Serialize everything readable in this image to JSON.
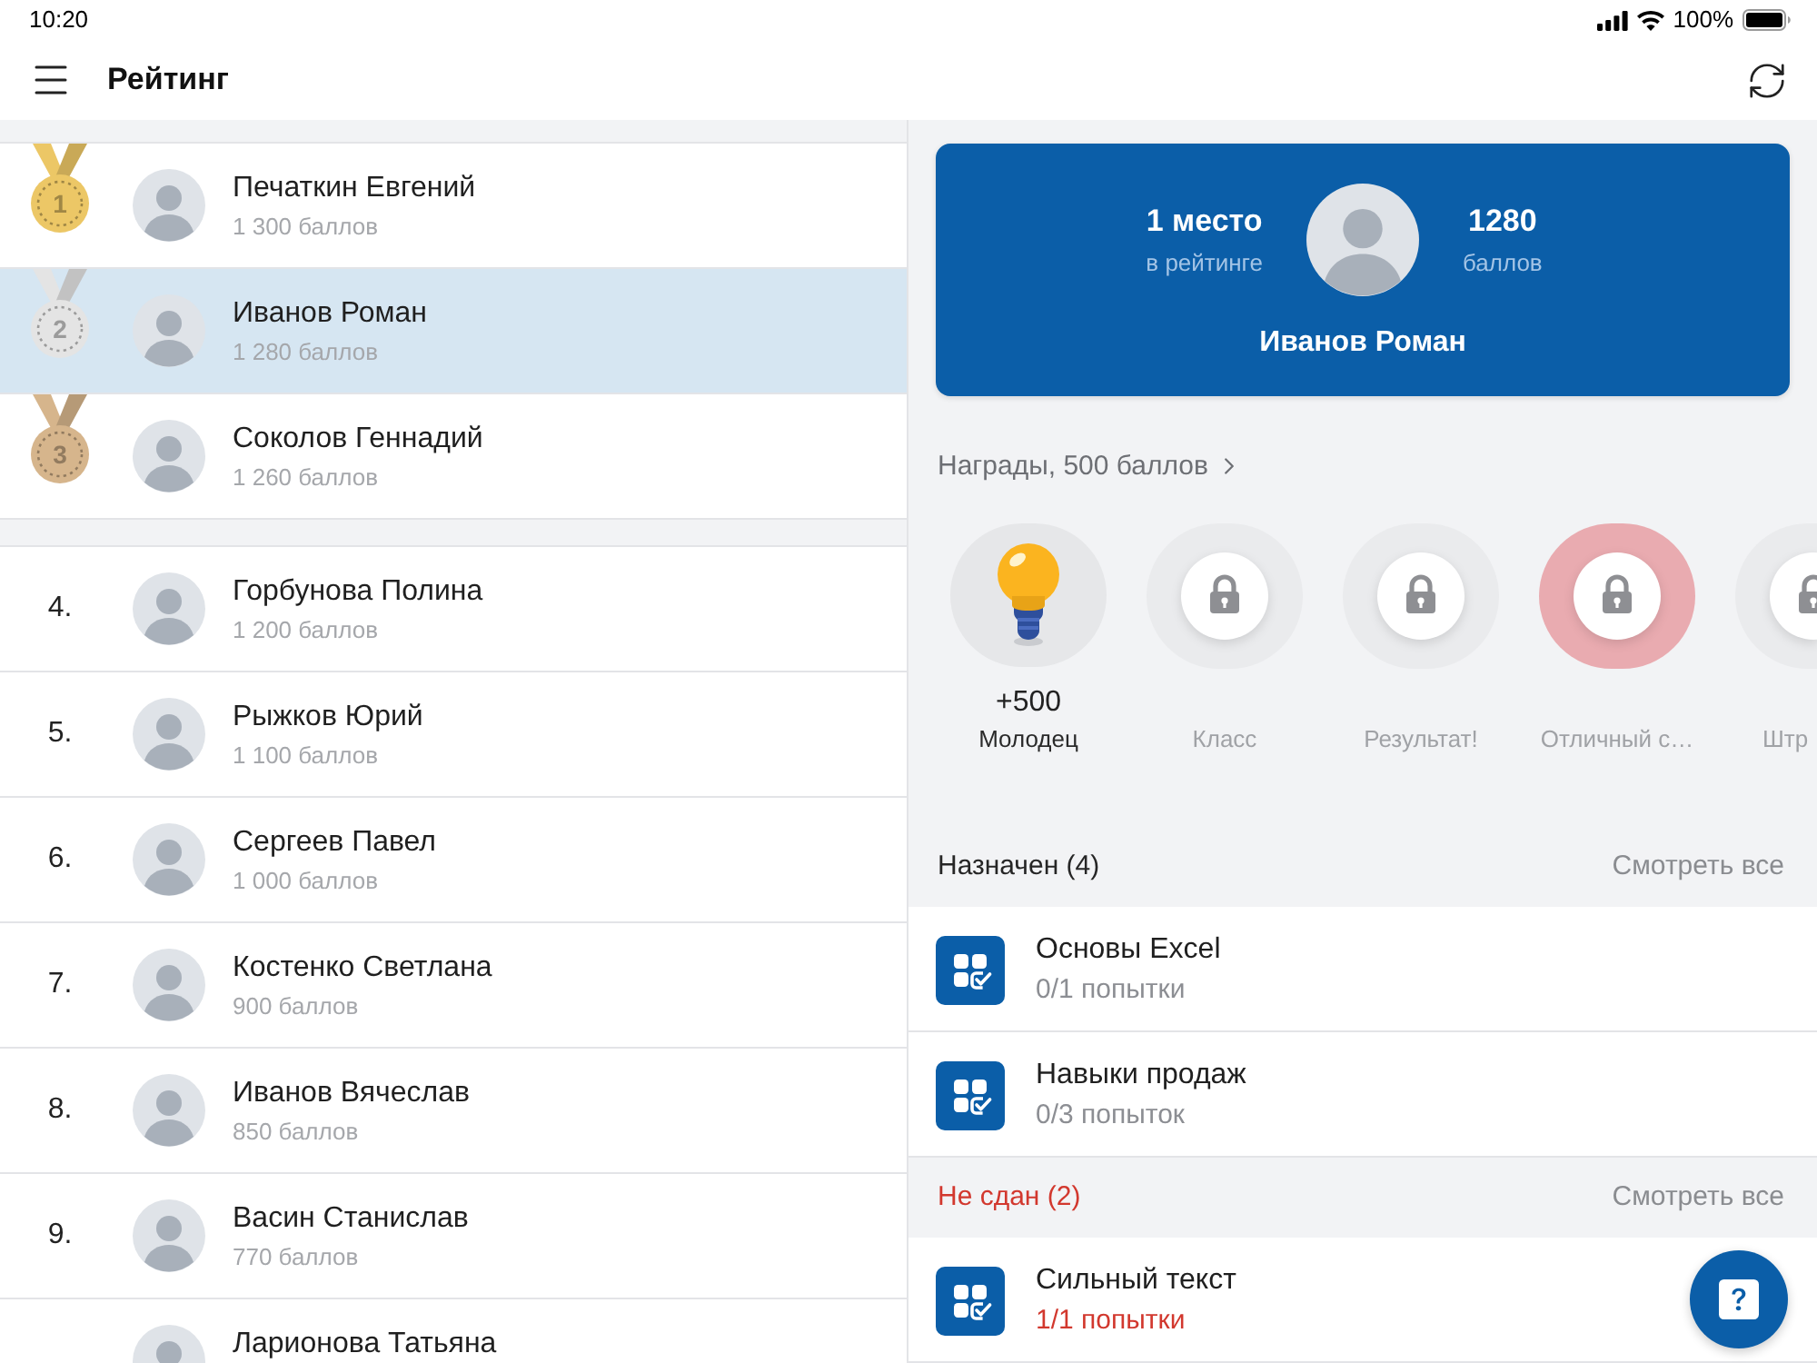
{
  "status_bar": {
    "time": "10:20",
    "battery": "100%"
  },
  "header": {
    "title": "Рейтинг"
  },
  "leaderboard": {
    "groups": [
      {
        "rows": [
          {
            "kind": "medal",
            "rank": "1",
            "color": "#ecc766",
            "name": "Печаткин Евгений",
            "points": "1 300 баллов",
            "selected": false
          },
          {
            "kind": "medal",
            "rank": "2",
            "color": "#e4e4e4",
            "name": "Иванов Роман",
            "points": "1 280 баллов",
            "selected": true
          },
          {
            "kind": "medal",
            "rank": "3",
            "color": "#d6b58c",
            "name": "Соколов Геннадий",
            "points": "1 260 баллов",
            "selected": false
          }
        ]
      },
      {
        "rows": [
          {
            "kind": "number",
            "rank": "4.",
            "name": "Горбунова Полина",
            "points": "1 200 баллов",
            "selected": false
          },
          {
            "kind": "number",
            "rank": "5.",
            "name": "Рыжков Юрий",
            "points": "1 100 баллов",
            "selected": false
          },
          {
            "kind": "number",
            "rank": "6.",
            "name": "Сергеев Павел",
            "points": "1 000 баллов",
            "selected": false
          },
          {
            "kind": "number",
            "rank": "7.",
            "name": "Костенко Светлана",
            "points": "900 баллов",
            "selected": false
          },
          {
            "kind": "number",
            "rank": "8.",
            "name": "Иванов Вячеслав",
            "points": "850 баллов",
            "selected": false
          },
          {
            "kind": "number",
            "rank": "9.",
            "name": "Васин Станислав",
            "points": "770 баллов",
            "selected": false
          },
          {
            "kind": "number",
            "name": "Ларионова Татьяна",
            "selected": false
          }
        ]
      }
    ]
  },
  "profile_card": {
    "place": "1 место",
    "place_caption": "в рейтинге",
    "points": "1280",
    "points_caption": "баллов",
    "name": "Иванов Роман"
  },
  "awards": {
    "link": "Награды, 500 баллов",
    "items": [
      {
        "kind": "unlocked",
        "color": "#e6e7e9",
        "points": "+500",
        "label": "Молодец"
      },
      {
        "kind": "locked",
        "color": "#eaebed",
        "label": "Класс"
      },
      {
        "kind": "locked",
        "color": "#eaebed",
        "label": "Результат!"
      },
      {
        "kind": "locked",
        "color": "#e9abb0",
        "label": "Отличный с…"
      },
      {
        "kind": "locked",
        "color": "#eaebed",
        "label": "Штр"
      }
    ]
  },
  "sections": [
    {
      "kind": "assigned",
      "title": "Назначен (4)",
      "link": "Смотреть все",
      "rows": [
        {
          "title": "Основы Excel",
          "subtitle": "0/1 попытки"
        },
        {
          "title": "Навыки продаж",
          "subtitle": "0/3 попыток"
        }
      ]
    },
    {
      "kind": "failed",
      "title": "Не сдан (2)",
      "link": "Смотреть все",
      "rows": [
        {
          "title": "Сильный текст",
          "subtitle": "1/1 попытки"
        }
      ]
    }
  ]
}
